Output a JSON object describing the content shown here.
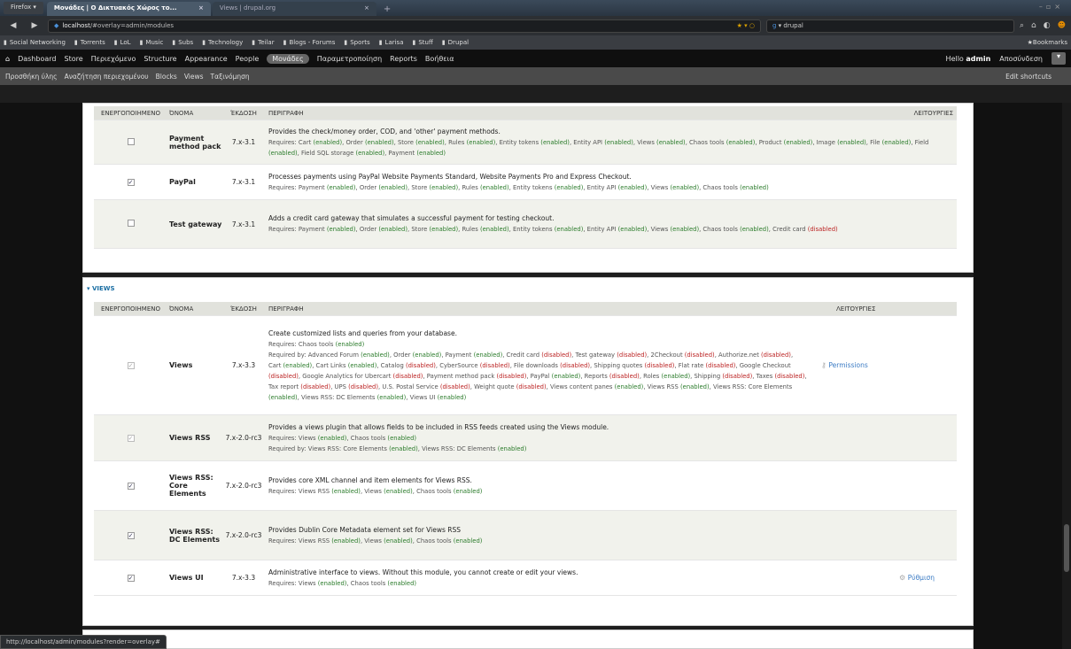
{
  "browser": {
    "ff_button": "Firefox ▾",
    "tabs": [
      {
        "title": "Μονάδες | Ο Δικτυακός Χώρος το...",
        "active": true
      },
      {
        "title": "Views | drupal.org",
        "active": false
      }
    ],
    "url_host": "localhost",
    "url_path": "/#overlay=admin/modules",
    "search_text": "drupal",
    "bookmarks": [
      "Social Networking",
      "Torrents",
      "LoL",
      "Music",
      "Subs",
      "Technology",
      "Teilar",
      "Blogs - Forums",
      "Sports",
      "Larisa",
      "Stuff",
      "Drupal"
    ],
    "bookmarks_right": "Bookmarks",
    "status_url": "http://localhost/admin/modules?render=overlay#"
  },
  "admin_toolbar": {
    "items": [
      "Dashboard",
      "Store",
      "Περιεχόμενο",
      "Structure",
      "Appearance",
      "People",
      "Μονάδες",
      "Παραμετροποίηση",
      "Reports",
      "Βοήθεια"
    ],
    "active": "Μονάδες",
    "hello_prefix": "Hello",
    "user": "admin",
    "logout": "Αποσύνδεση"
  },
  "shortcuts": {
    "items": [
      "Προσθήκη ύλης",
      "Αναζήτηση περιεχομένου",
      "Blocks",
      "Views",
      "Ταξινόμηση"
    ],
    "edit": "Edit shortcuts"
  },
  "columns": {
    "enabled": "ΕΝΕΡΓΟΠΟΙΗΜΕΝΟ",
    "name": "ΌΝΟΜΑ",
    "version": "ΈΚΔΟΣΗ",
    "description": "ΠΕΡΙΓΡΑΦΗ",
    "ops": "ΛΕΙΤΟΥΡΓΙΕΣ"
  },
  "payment_modules": [
    {
      "name": "Payment method pack",
      "version": "7.x-3.1",
      "checked": false,
      "desc": "Provides the check/money order, COD, and 'other' payment methods.",
      "requires": "Requires: Cart (enabled), Order (enabled), Store (enabled), Rules (enabled), Entity tokens (enabled), Entity API (enabled), Views (enabled), Chaos tools (enabled), Product (enabled), Image (enabled), File (enabled), Field (enabled), Field SQL storage (enabled), Payment (enabled)"
    },
    {
      "name": "PayPal",
      "version": "7.x-3.1",
      "checked": true,
      "desc": "Processes payments using PayPal Website Payments Standard, Website Payments Pro and Express Checkout.",
      "requires": "Requires: Payment (enabled), Order (enabled), Store (enabled), Rules (enabled), Entity tokens (enabled), Entity API (enabled), Views (enabled), Chaos tools (enabled)"
    },
    {
      "name": "Test gateway",
      "version": "7.x-3.1",
      "checked": false,
      "desc": "Adds a credit card gateway that simulates a successful payment for testing checkout.",
      "requires": "Requires: Payment (enabled), Order (enabled), Store (enabled), Rules (enabled), Entity tokens (enabled), Entity API (enabled), Views (enabled), Chaos tools (enabled), Credit card (disabled)"
    }
  ],
  "views_legend": "▾ VIEWS",
  "views_modules": [
    {
      "name": "Views",
      "version": "7.x-3.3",
      "checked": true,
      "locked": true,
      "desc": "Create customized lists and queries from your database.",
      "requires": "Requires: Chaos tools (enabled)",
      "required_by": "Required by: Advanced Forum (enabled), Order (enabled), Payment (enabled), Credit card (disabled), Test gateway (disabled), 2Checkout (disabled), Authorize.net (disabled), Cart (enabled), Cart Links (enabled), Catalog (disabled), CyberSource (disabled), File downloads (disabled), Shipping quotes (disabled), Flat rate (disabled), Google Checkout (disabled), Google Analytics for Ubercart (disabled), Payment method pack (disabled), PayPal (enabled), Reports (disabled), Roles (enabled), Shipping (disabled), Taxes (disabled), Tax report (disabled), UPS (disabled), U.S. Postal Service (disabled), Weight quote (disabled), Views content panes (enabled), Views RSS (enabled), Views RSS: Core Elements (enabled), Views RSS: DC Elements (enabled), Views UI (enabled)",
      "op": "Permissions"
    },
    {
      "name": "Views RSS",
      "version": "7.x-2.0-rc3",
      "checked": true,
      "locked": true,
      "desc": "Provides a views plugin that allows fields to be included in RSS feeds created using the Views module.",
      "requires": "Requires: Views (enabled), Chaos tools (enabled)",
      "required_by": "Required by: Views RSS: Core Elements (enabled), Views RSS: DC Elements (enabled)",
      "op": ""
    },
    {
      "name": "Views RSS: Core Elements",
      "version": "7.x-2.0-rc3",
      "checked": true,
      "locked": false,
      "desc": "Provides core XML channel and item elements for Views RSS.",
      "requires": "Requires: Views RSS (enabled), Views (enabled), Chaos tools (enabled)",
      "required_by": "",
      "op": ""
    },
    {
      "name": "Views RSS: DC Elements",
      "version": "7.x-2.0-rc3",
      "checked": true,
      "locked": false,
      "desc": "Provides Dublin Core Metadata element set for Views RSS",
      "requires": "Requires: Views RSS (enabled), Views (enabled), Chaos tools (enabled)",
      "required_by": "",
      "op": ""
    },
    {
      "name": "Views UI",
      "version": "7.x-3.3",
      "checked": true,
      "locked": false,
      "desc": "Administrative interface to views. Without this module, you cannot create or edit your views.",
      "requires": "Requires: Views (enabled), Chaos tools (enabled)",
      "required_by": "",
      "op": "Ρύθμιση"
    }
  ]
}
